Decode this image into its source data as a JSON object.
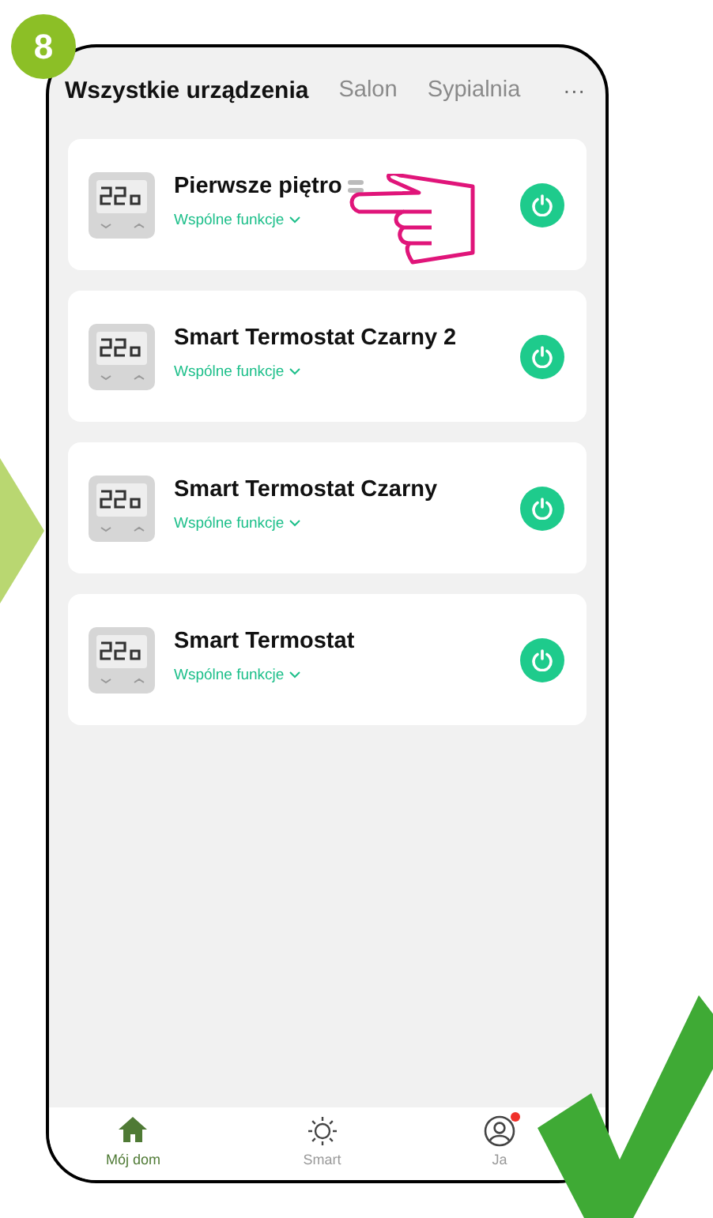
{
  "step_badge": "8",
  "tabs": [
    {
      "label": "Wszystkie urządzenia",
      "selected": true
    },
    {
      "label": "Salon",
      "selected": false
    },
    {
      "label": "Sypialnia",
      "selected": false
    }
  ],
  "more_menu": "···",
  "devices": [
    {
      "name": "Pierwsze piętro",
      "group": true,
      "subtitle": "Wspólne funkcje",
      "on": true,
      "pointed": true
    },
    {
      "name": "Smart Termostat Czarny 2",
      "group": false,
      "subtitle": "Wspólne funkcje",
      "on": true,
      "pointed": false
    },
    {
      "name": "Smart Termostat Czarny",
      "group": false,
      "subtitle": "Wspólne funkcje",
      "on": true,
      "pointed": false
    },
    {
      "name": "Smart Termostat",
      "group": false,
      "subtitle": "Wspólne funkcje",
      "on": true,
      "pointed": false
    }
  ],
  "nav": [
    {
      "kind": "home",
      "label": "Mój dom",
      "selected": true,
      "notification": false
    },
    {
      "kind": "smart",
      "label": "Smart",
      "selected": false,
      "notification": false
    },
    {
      "kind": "profile",
      "label": "Ja",
      "selected": false,
      "notification": true
    }
  ]
}
